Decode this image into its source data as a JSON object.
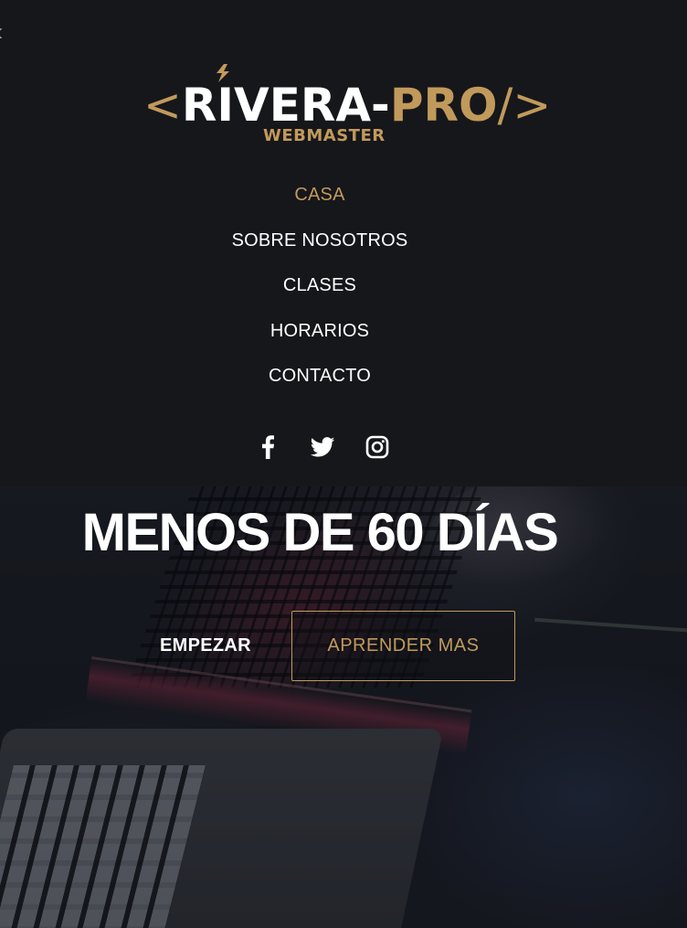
{
  "colors": {
    "accent": "#c19a5b",
    "background": "#16171b",
    "text": "#ffffff"
  },
  "logo": {
    "bracket_open": "<",
    "name_white": "RIVERA-",
    "name_gold": "PRO",
    "bracket_close": "/>",
    "subtitle_left": "WEB",
    "subtitle_right": "MASTER"
  },
  "nav": {
    "items": [
      {
        "label": "CASA",
        "active": true
      },
      {
        "label": "SOBRE NOSOTROS",
        "active": false
      },
      {
        "label": "CLASES",
        "active": false
      },
      {
        "label": "HORARIOS",
        "active": false
      },
      {
        "label": "CONTACTO",
        "active": false
      }
    ]
  },
  "social": {
    "icons": [
      "facebook-icon",
      "twitter-icon",
      "instagram-icon"
    ]
  },
  "hero": {
    "headline": "MENOS DE 60 DÍAS",
    "primary_button": "EMPEZAR",
    "secondary_button": "APRENDER MAS"
  }
}
